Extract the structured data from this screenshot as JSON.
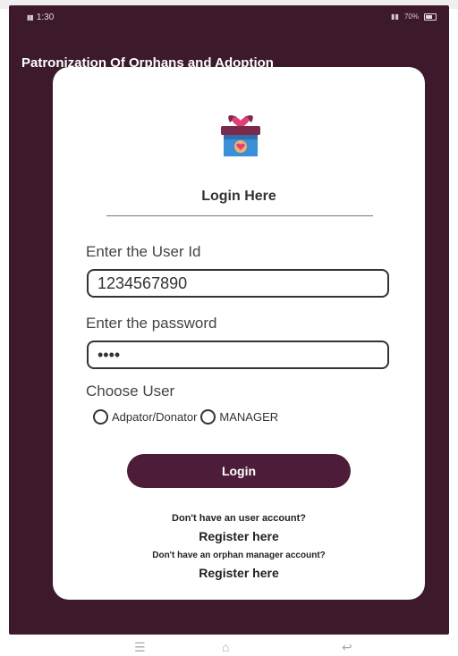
{
  "status": {
    "time": "1:30",
    "right_text": "70%"
  },
  "app": {
    "title": "Patronization Of Orphans and Adoption"
  },
  "login": {
    "heading": "Login Here",
    "user_id_label": "Enter the User Id",
    "user_id_value": "1234567890",
    "password_label": "Enter the password",
    "password_value": "1234",
    "choose_user_label": "Choose User",
    "options": [
      "Adpator/Donator",
      "MANAGER"
    ],
    "button_label": "Login",
    "no_user_account": "Don't have an user account?",
    "register_user": "Register here",
    "no_manager_account": "Don't have an orphan manager account?",
    "register_manager": "Register here"
  },
  "colors": {
    "background": "#3c1a2c",
    "button": "#4d1c38",
    "card": "#ffffff"
  },
  "icons": [
    "gift-box-heart-icon",
    "signal-icon",
    "battery-icon",
    "menu-icon",
    "home-icon",
    "back-icon"
  ]
}
